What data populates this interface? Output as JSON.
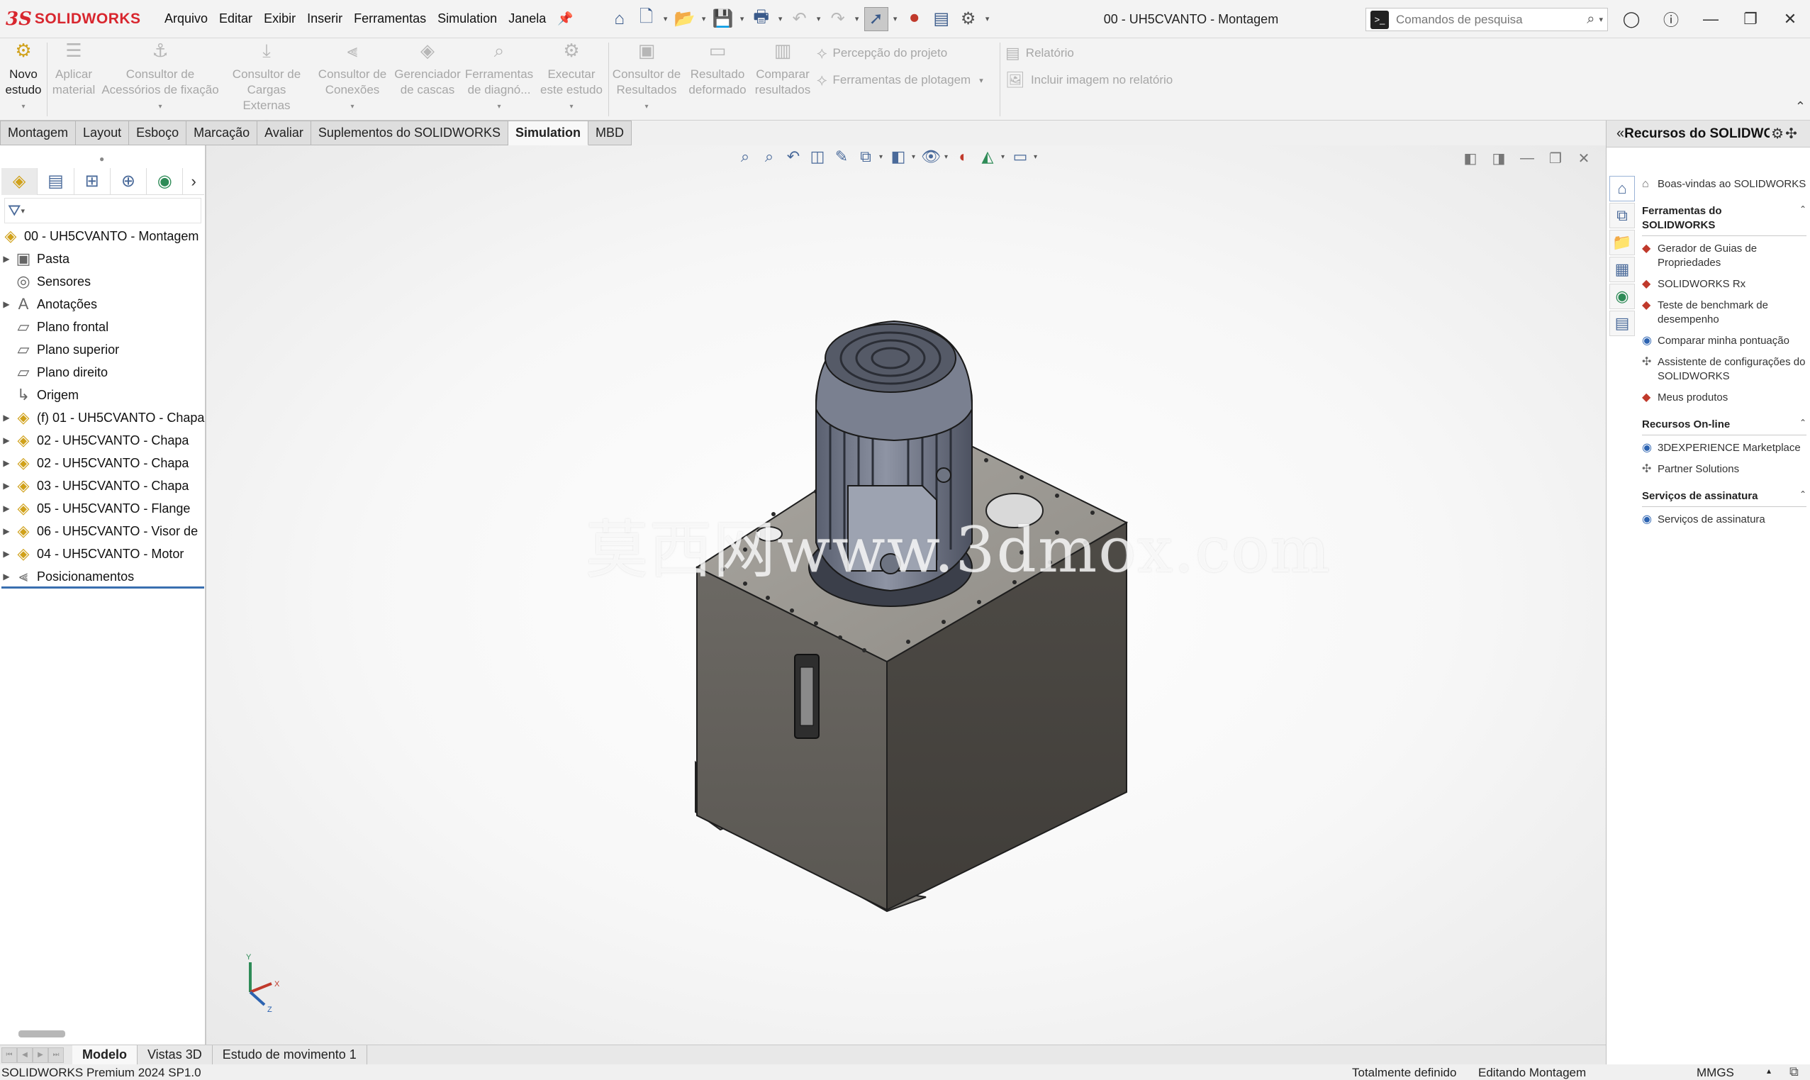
{
  "app": {
    "logo_ds": "3S",
    "logo_name": "SOLIDWORKS",
    "document_title": "00 - UH5CVANTO - Montagem",
    "menu": [
      "Arquivo",
      "Editar",
      "Exibir",
      "Inserir",
      "Ferramentas",
      "Simulation",
      "Janela"
    ],
    "search_placeholder": "Comandos de pesquisa"
  },
  "command_manager": {
    "buttons": [
      {
        "line1": "Novo",
        "line2": "estudo",
        "icon": "new-study-icon",
        "active": true
      },
      {
        "line1": "Aplicar",
        "line2": "material",
        "icon": "apply-material-icon"
      },
      {
        "line1": "Consultor de",
        "line2": "Acessórios de fixação",
        "icon": "fixtures-advisor-icon"
      },
      {
        "line1": "Consultor de",
        "line2": "Cargas Externas",
        "icon": "external-loads-advisor-icon"
      },
      {
        "line1": "Consultor de",
        "line2": "Conexões",
        "icon": "connections-advisor-icon"
      },
      {
        "line1": "Gerenciador",
        "line2": "de cascas",
        "icon": "shell-manager-icon"
      },
      {
        "line1": "Ferramentas",
        "line2": "de diagnó...",
        "icon": "diagnostic-tools-icon"
      },
      {
        "line1": "Executar",
        "line2": "este estudo",
        "icon": "run-study-icon"
      },
      {
        "line1": "Consultor de",
        "line2": "Resultados",
        "icon": "results-advisor-icon"
      },
      {
        "line1": "Resultado",
        "line2": "deformado",
        "icon": "deformed-result-icon"
      },
      {
        "line1": "Comparar",
        "line2": "resultados",
        "icon": "compare-results-icon"
      }
    ],
    "right_items": {
      "design_insight": "Percepção do projeto",
      "plot_tools": "Ferramentas de plotagem",
      "report": "Relatório",
      "include_image": "Incluir imagem no relatório"
    }
  },
  "tabs": [
    "Montagem",
    "Layout",
    "Esboço",
    "Marcação",
    "Avaliar",
    "Suplementos do SOLIDWORKS",
    "Simulation",
    "MBD"
  ],
  "active_tab": "Simulation",
  "feature_tree": {
    "root": "00 - UH5CVANTO - Montagem",
    "nodes": [
      {
        "label": "Pasta",
        "icon": "folder-icon",
        "expand": true
      },
      {
        "label": "Sensores",
        "icon": "sensor-icon",
        "expand": false
      },
      {
        "label": "Anotações",
        "icon": "annotation-icon",
        "expand": true
      },
      {
        "label": "Plano frontal",
        "icon": "plane-icon",
        "expand": false
      },
      {
        "label": "Plano superior",
        "icon": "plane-icon",
        "expand": false
      },
      {
        "label": "Plano direito",
        "icon": "plane-icon",
        "expand": false
      },
      {
        "label": "Origem",
        "icon": "origin-icon",
        "expand": false
      },
      {
        "label": "(f) 01 - UH5CVANTO - Chapa",
        "icon": "part-icon",
        "expand": true
      },
      {
        "label": "02 - UH5CVANTO - Chapa",
        "icon": "part-icon",
        "expand": true
      },
      {
        "label": "02 - UH5CVANTO - Chapa",
        "icon": "part-icon",
        "expand": true
      },
      {
        "label": "03 - UH5CVANTO - Chapa",
        "icon": "part-icon",
        "expand": true
      },
      {
        "label": "05 - UH5CVANTO - Flange",
        "icon": "part-icon",
        "expand": true
      },
      {
        "label": "06 - UH5CVANTO - Visor de",
        "icon": "part-icon",
        "expand": true
      },
      {
        "label": "04 - UH5CVANTO - Motor",
        "icon": "part-icon",
        "expand": true
      },
      {
        "label": "Posicionamentos",
        "icon": "mates-icon",
        "expand": true
      }
    ]
  },
  "viewport": {
    "watermark": "莫西网www.3dmox.com",
    "triad": {
      "x": "X",
      "y": "Y",
      "z": "Z"
    }
  },
  "bottom_tabs": [
    "Modelo",
    "Vistas 3D",
    "Estudo de movimento 1"
  ],
  "active_bottom_tab": "Modelo",
  "status": {
    "product": "SOLIDWORKS Premium 2024 SP1.0",
    "defined": "Totalmente definido",
    "editing": "Editando Montagem",
    "units": "MMGS",
    "caret": "▴"
  },
  "task_pane": {
    "title": "Recursos do SOLIDWORKS",
    "welcome": "Boas-vindas ao SOLIDWORKS",
    "sections": [
      {
        "title": "Ferramentas do SOLIDWORKS",
        "items": [
          {
            "label": "Gerador de Guias de Propriedades",
            "color": "red"
          },
          {
            "label": "SOLIDWORKS Rx",
            "color": "red"
          },
          {
            "label": "Teste de benchmark de desempenho",
            "color": "red"
          },
          {
            "label": "Comparar minha pontuação",
            "color": "blue"
          },
          {
            "label": "Assistente de configurações do SOLIDWORKS",
            "color": "grey"
          },
          {
            "label": "Meus produtos",
            "color": "red"
          }
        ]
      },
      {
        "title": "Recursos On-line",
        "items": [
          {
            "label": "3DEXPERIENCE Marketplace",
            "color": "blue"
          },
          {
            "label": "Partner Solutions",
            "color": "grey"
          }
        ]
      },
      {
        "title": "Serviços de assinatura",
        "items": [
          {
            "label": "Serviços de assinatura",
            "color": "blue"
          }
        ]
      }
    ]
  }
}
